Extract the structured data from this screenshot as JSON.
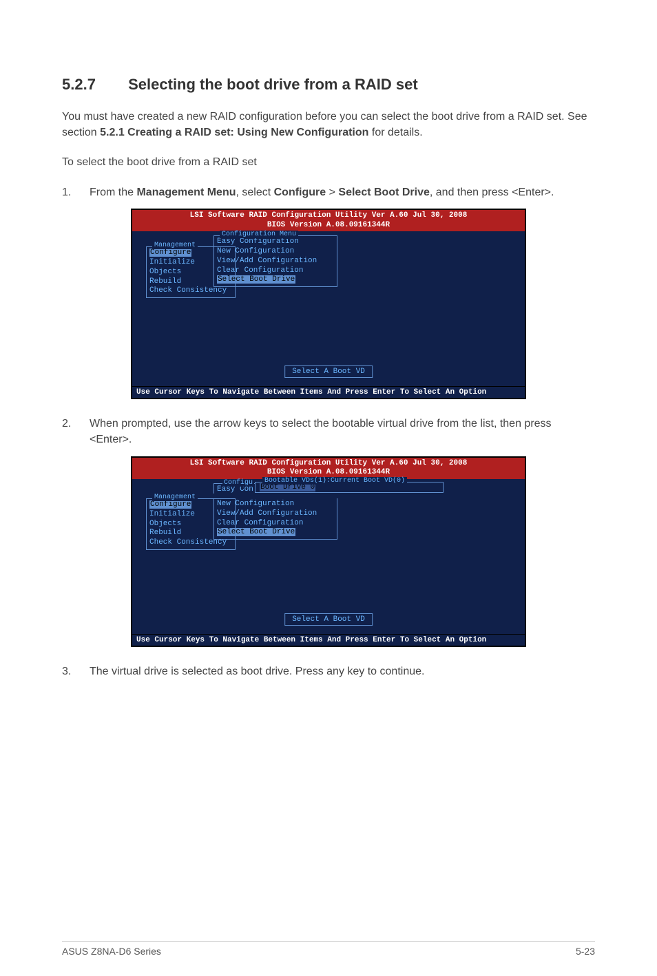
{
  "heading": {
    "number": "5.2.7",
    "title": "Selecting the boot drive from a RAID set"
  },
  "intro": {
    "line1": "You must have created a new RAID configuration before you can select the boot drive from a RAID set. See section ",
    "ref": "5.2.1 Creating a RAID set: Using New Configuration",
    "line1b": " for details.",
    "line2": "To select the boot drive from a RAID set"
  },
  "steps": [
    {
      "num": "1.",
      "pre": "From the ",
      "b1": "Management Menu",
      "mid": ", select ",
      "b2": "Configure",
      "gt": " > ",
      "b3": "Select Boot Drive",
      "post": ", and then press <Enter>."
    },
    {
      "num": "2.",
      "text": "When prompted, use the arrow keys to select the bootable virtual drive from the list, then press <Enter>."
    },
    {
      "num": "3.",
      "text": "The virtual drive is selected as boot drive. Press any key to continue."
    }
  ],
  "bios": {
    "header1": "LSI Software RAID Configuration Utility Ver A.60 Jul 30, 2008",
    "header2": "BIOS Version  A.08.09161344R",
    "footer": "Use Cursor Keys To Navigate Between Items And Press Enter To Select An Option",
    "msg": "Select A Boot VD",
    "mgmt_legend": "Management",
    "mgmt_items": [
      "Configure",
      "Initialize",
      "Objects",
      "Rebuild",
      "Check Consistency"
    ],
    "cfg_legend": "Configuration Menu",
    "cfg_items": [
      "Easy Configuration",
      "New Configuration",
      "View/Add Configuration",
      "Clear Configuration",
      "Select Boot Drive"
    ],
    "cfg_short_legend": "Configu",
    "easy_con": "Easy Con",
    "boot_legend": "Bootable VDs(1):Current Boot VD(0)",
    "boot_item": "Boot Drive 0"
  },
  "page_footer": {
    "left": "ASUS Z8NA-D6 Series",
    "right": "5-23"
  }
}
